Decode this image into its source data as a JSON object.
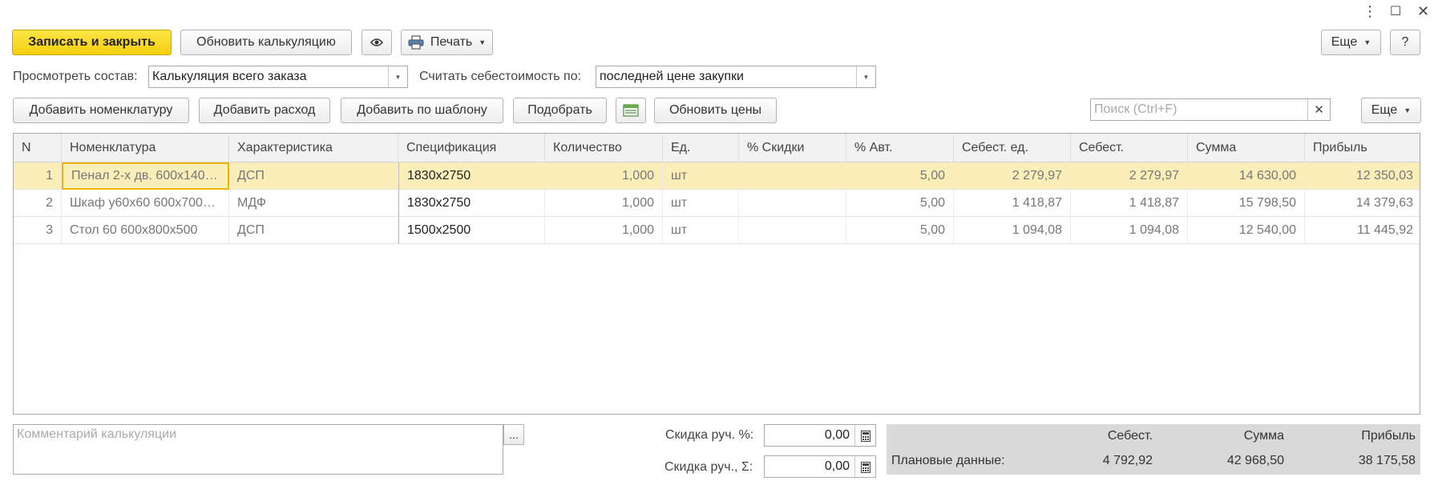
{
  "window": {
    "more_icon": "⋮",
    "maximize_icon": "☐",
    "close_icon": "✕"
  },
  "toolbar": {
    "save_close": "Записать и закрыть",
    "update_calc": "Обновить калькуляцию",
    "print": "Печать",
    "more": "Еще",
    "help": "?"
  },
  "filters": {
    "view_label": "Просмотреть состав:",
    "view_value": "Калькуляция всего заказа",
    "cost_label": "Считать себестоимость по:",
    "cost_value": "последней цене закупки"
  },
  "actions": {
    "add_nomenclature": "Добавить номенклатуру",
    "add_expense": "Добавить расход",
    "add_template": "Добавить по шаблону",
    "pick": "Подобрать",
    "update_prices": "Обновить цены",
    "search_placeholder": "Поиск (Ctrl+F)",
    "more": "Еще"
  },
  "table": {
    "headers": {
      "n": "N",
      "nomenclature": "Номенклатура",
      "characteristic": "Характеристика",
      "specification": "Спецификация",
      "quantity": "Количество",
      "unit": "Ед.",
      "discount": "% Скидки",
      "auto": "% Авт.",
      "unit_cost": "Себест. ед.",
      "cost": "Себест.",
      "sum": "Сумма",
      "profit": "Прибыль"
    },
    "rows": [
      {
        "n": "1",
        "nomenclature": "Пенал 2-х дв. 600x140…",
        "characteristic": "ДСП",
        "specification": "1830x2750",
        "quantity": "1,000",
        "unit": "шт",
        "discount": "",
        "auto": "5,00",
        "unit_cost": "2 279,97",
        "cost": "2 279,97",
        "sum": "14 630,00",
        "profit": "12 350,03"
      },
      {
        "n": "2",
        "nomenclature": "Шкаф у60х60 600х700…",
        "characteristic": "МДФ",
        "specification": "1830x2750",
        "quantity": "1,000",
        "unit": "шт",
        "discount": "",
        "auto": "5,00",
        "unit_cost": "1 418,87",
        "cost": "1 418,87",
        "sum": "15 798,50",
        "profit": "14 379,63"
      },
      {
        "n": "3",
        "nomenclature": "Стол 60 600x800x500",
        "characteristic": "ДСП",
        "specification": "1500x2500",
        "quantity": "1,000",
        "unit": "шт",
        "discount": "",
        "auto": "5,00",
        "unit_cost": "1 094,08",
        "cost": "1 094,08",
        "sum": "12 540,00",
        "profit": "11 445,92"
      }
    ]
  },
  "bottom": {
    "comment_placeholder": "Комментарий калькуляции",
    "comment_btn": "...",
    "disc_pct_label": "Скидка руч. %:",
    "disc_pct_value": "0,00",
    "disc_sum_label": "Скидка руч., Σ:",
    "disc_sum_value": "0,00"
  },
  "summary": {
    "cost_header": "Себест.",
    "sum_header": "Сумма",
    "profit_header": "Прибыль",
    "row_label": "Плановые данные:",
    "cost": "4 792,92",
    "sum": "42 968,50",
    "profit": "38 175,58"
  }
}
